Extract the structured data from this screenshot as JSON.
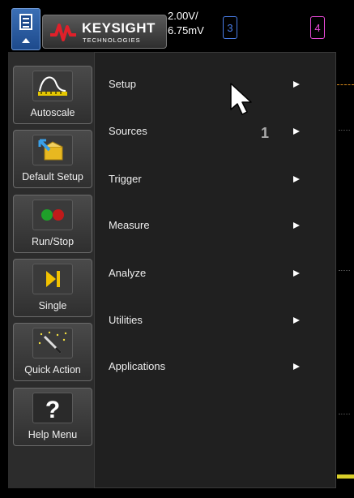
{
  "header": {
    "brand_name": "KEYSIGHT",
    "brand_sub": "TECHNOLOGIES",
    "scale_line1": "2.00V/",
    "scale_line2": "6.75mV",
    "channel3": "3",
    "channel4": "4"
  },
  "sidebar": {
    "buttons": [
      {
        "label": "Autoscale",
        "icon": "autoscale-icon"
      },
      {
        "label": "Default Setup",
        "icon": "default-setup-icon"
      },
      {
        "label": "Run/Stop",
        "icon": "run-stop-icon"
      },
      {
        "label": "Single",
        "icon": "single-icon"
      },
      {
        "label": "Quick Action",
        "icon": "quick-action-icon"
      },
      {
        "label": "Help Menu",
        "icon": "help-icon"
      }
    ]
  },
  "menu": {
    "items": [
      {
        "label": "Setup"
      },
      {
        "label": "Sources"
      },
      {
        "label": "Trigger"
      },
      {
        "label": "Measure"
      },
      {
        "label": "Analyze"
      },
      {
        "label": "Utilities"
      },
      {
        "label": "Applications"
      }
    ]
  },
  "pointer_number": "1",
  "colors": {
    "channel3": "#4a7ee8",
    "channel4": "#e84ad8",
    "keysight_red": "#e0202a",
    "run_green": "#1fa02a",
    "stop_red": "#c01a1a",
    "single_yellow": "#f2c200"
  }
}
